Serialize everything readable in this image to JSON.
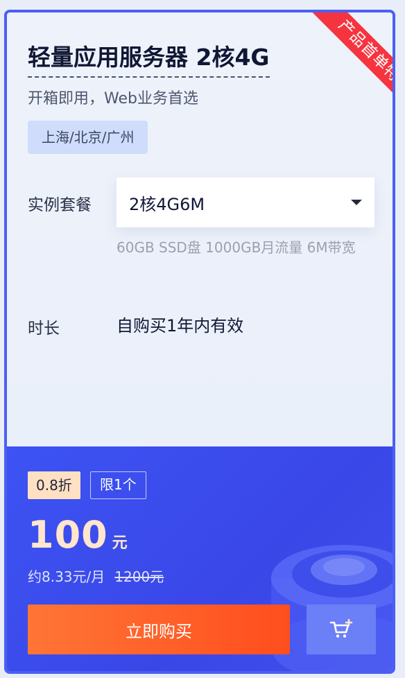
{
  "card": {
    "ribbon": "产品首单特惠",
    "title": "轻量应用服务器 2核4G",
    "subtitle": "开箱即用，Web业务首选",
    "region": "上海/北京/广州",
    "instance_label": "实例套餐",
    "instance_value": "2核4G6M",
    "instance_desc": "60GB SSD盘 1000GB月流量 6M带宽",
    "duration_label": "时长",
    "duration_value": "自购买1年内有效"
  },
  "pricing": {
    "discount": "0.8折",
    "limit": "限1个",
    "price": "100",
    "price_unit": "元",
    "monthly": "约8.33元/月",
    "original": "1200元",
    "buy_label": "立即购买"
  },
  "icons": {
    "dropdown": "chevron-down-icon",
    "cart": "add-to-cart-icon"
  },
  "colors": {
    "accent": "#4a60f2",
    "buy": "#ff5a26",
    "ribbon": "#f6343f",
    "price": "#ffe6cc"
  }
}
